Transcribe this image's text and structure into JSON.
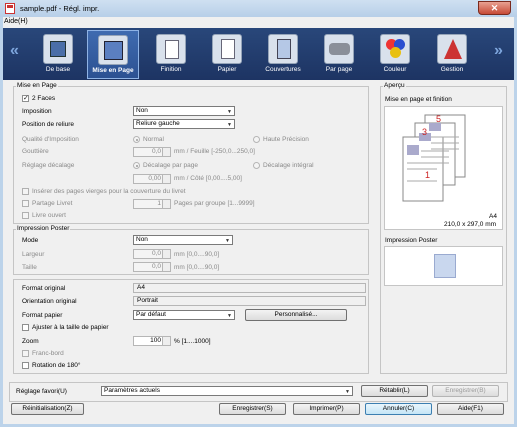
{
  "window": {
    "title": "sample.pdf - Régl. impr.",
    "close": "✕"
  },
  "menu": {
    "help": "Aide(H)"
  },
  "toolbar": {
    "left_arrow": "«",
    "right_arrow": "»",
    "tabs": [
      {
        "label": "De base",
        "icon": "basic-icon"
      },
      {
        "label": "Mise en Page",
        "icon": "layout-icon",
        "selected": true
      },
      {
        "label": "Finition",
        "icon": "finishing-icon"
      },
      {
        "label": "Papier",
        "icon": "paper-icon"
      },
      {
        "label": "Couvertures",
        "icon": "covers-icon"
      },
      {
        "label": "Par page",
        "icon": "per-page-icon"
      },
      {
        "label": "Couleur",
        "icon": "color-icon"
      },
      {
        "label": "Gestion",
        "icon": "management-icon"
      }
    ]
  },
  "layout": {
    "group_title": "Mise en Page",
    "two_sided": "2 Faces",
    "imposition_label": "Imposition",
    "imposition_value": "Non",
    "binding_label": "Position de reliure",
    "binding_value": "Reliure gauche",
    "imposition_quality_label": "Qualité d'Imposition",
    "quality_normal": "Normal",
    "quality_high": "Haute Précision",
    "gutter_label": "Gouttière",
    "gutter_value": "0,0",
    "gutter_unit": "mm / Feuille [-250,0...250,0]",
    "shift_label": "Réglage décalage",
    "shift_per_page": "Décalage par page",
    "shift_full": "Décalage intégral",
    "shift_value": "0,00",
    "shift_unit": "mm / Côté [0,00....5,00]",
    "insert_blank": "Insérer des pages vierges pour la couverture du livret",
    "split_booklet": "Partage Livret",
    "pages_per_group_value": "1",
    "pages_per_group_unit": "Pages par groupe [1...9999]",
    "open_book": "Livre ouvert"
  },
  "poster": {
    "group_title": "Impression Poster",
    "mode_label": "Mode",
    "mode_value": "Non",
    "width_label": "Largeur",
    "width_value": "0,0",
    "width_unit": "mm [0,0....90,0]",
    "size_label": "Taille",
    "size_value": "0,0",
    "size_unit": "mm [0,0....90,0]"
  },
  "paper": {
    "original_format_label": "Format original",
    "original_format_value": "A4",
    "original_orientation_label": "Orientation original",
    "original_orientation_value": "Portrait",
    "paper_format_label": "Format papier",
    "paper_format_value": "Par défaut",
    "custom_button": "Personnalisé...",
    "fit_to_paper": "Ajuster à la taille de papier",
    "zoom_label": "Zoom",
    "zoom_value": "100",
    "zoom_unit": "% [1....1000]",
    "bleed": "Franc-bord",
    "rotate": "Rotation de 180°"
  },
  "preview": {
    "group_title": "Aperçu",
    "subtitle": "Mise en page et finition",
    "paper_name": "A4",
    "paper_size": "210,0 x 297,0 mm",
    "page_numbers": [
      "5",
      "3",
      "1"
    ],
    "poster_title": "Impression Poster"
  },
  "favorites": {
    "label": "Réglage favori(U)",
    "value": "Paramètres actuels",
    "restore": "Rétablir(L)",
    "save": "Enregistrer(B)"
  },
  "buttons": {
    "reset": "Réinitialisation(Z)",
    "save": "Enregistrer(S)",
    "print": "Imprimer(P)",
    "cancel": "Annuler(C)",
    "help": "Aide(F1)"
  },
  "colors": {
    "toolbar": "#1d3463",
    "accent": "#3c7fb1",
    "page_number": "#cc2222"
  }
}
